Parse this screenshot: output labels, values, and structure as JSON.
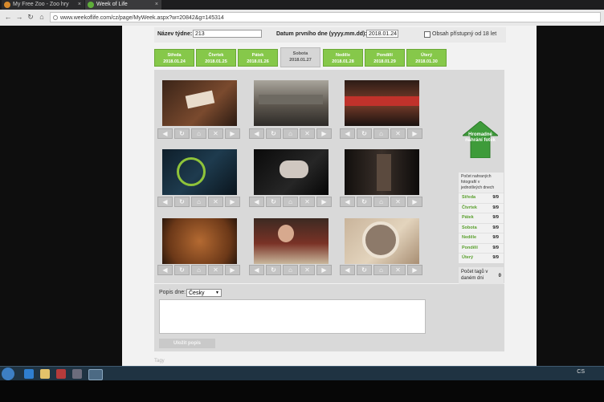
{
  "browser": {
    "tabs": [
      {
        "title": "My Free Zoo - Zoo hry"
      },
      {
        "title": "Week of Life"
      }
    ],
    "url": "www.weekoflife.com/cz/page/MyWeek.aspx?w=20842&g=145314",
    "close_glyph": "×"
  },
  "week": {
    "name_label": "Název týdne:",
    "name_value": "213",
    "start_label": "Datum prvního dne (yyyy.mm.dd):",
    "start_value": "2018.01.24",
    "adult_label": "Obsah přístupný od 18 let"
  },
  "days": [
    {
      "name": "Středa",
      "date": "2018.01.24"
    },
    {
      "name": "Čtvrtek",
      "date": "2018.01.25"
    },
    {
      "name": "Pátek",
      "date": "2018.01.26"
    },
    {
      "name": "Sobota",
      "date": "2018.01.27"
    },
    {
      "name": "Neděle",
      "date": "2018.01.28"
    },
    {
      "name": "Pondělí",
      "date": "2018.01.29"
    },
    {
      "name": "Úterý",
      "date": "2018.01.30"
    }
  ],
  "active_day_index": 3,
  "upload": {
    "label": "Hromadné nahrání fotek"
  },
  "stats": {
    "header": "Počet nahraných fotografií v jednotlivých dnech",
    "rows": [
      {
        "day": "Středa",
        "count": "9/9"
      },
      {
        "day": "Čtvrtek",
        "count": "9/9"
      },
      {
        "day": "Pátek",
        "count": "9/9"
      },
      {
        "day": "Sobota",
        "count": "9/9"
      },
      {
        "day": "Neděle",
        "count": "9/9"
      },
      {
        "day": "Pondělí",
        "count": "9/9"
      },
      {
        "day": "Úterý",
        "count": "9/9"
      }
    ],
    "tags_label": "Počet tagů v daném dni",
    "tags_count": "0"
  },
  "description": {
    "label": "Popis dne:",
    "language": "Česky",
    "save_label": "Uložit popis"
  },
  "footer": {
    "label": "Tagy"
  },
  "taskbar": {
    "language": "CS"
  },
  "colors": {
    "accent_green": "#86c84a",
    "day_green": "#5aa02e"
  }
}
